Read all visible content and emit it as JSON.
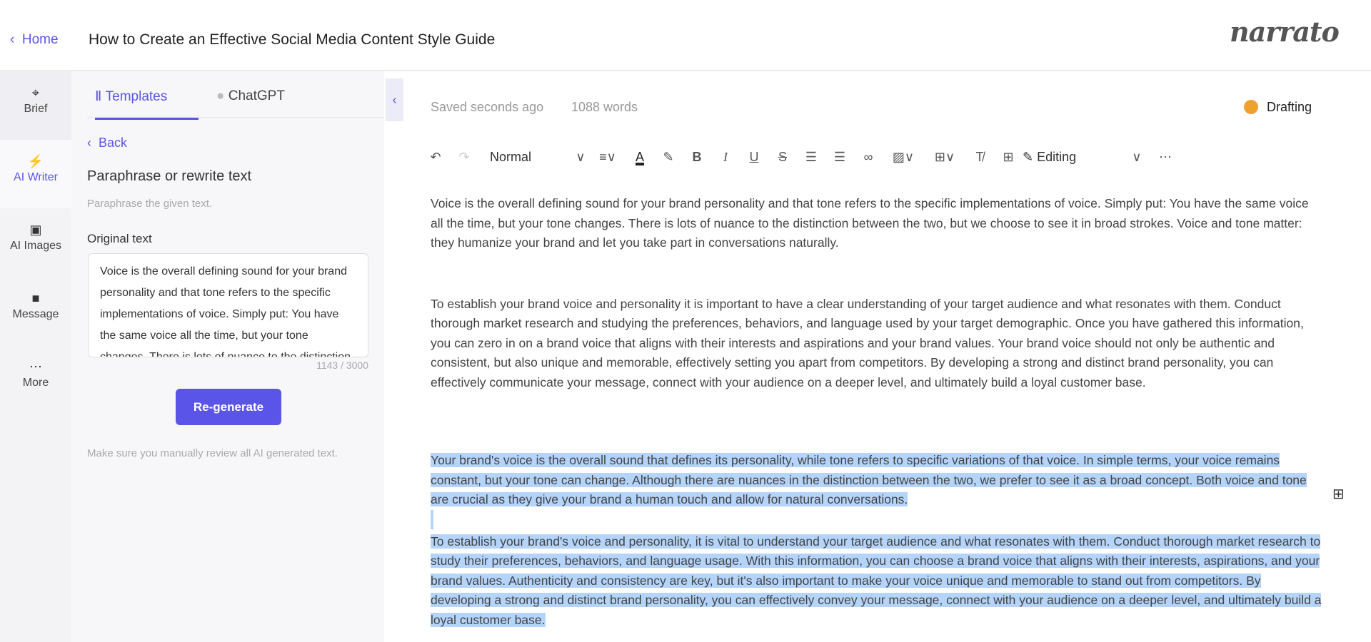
{
  "header": {
    "home_label": "Home",
    "title": "How to Create an Effective Social Media Content Style Guide",
    "logo": "narrato"
  },
  "rail": {
    "items": [
      {
        "label": "Brief",
        "icon": "crosshair-icon"
      },
      {
        "label": "AI Writer",
        "icon": "lightning-icon",
        "active": true
      },
      {
        "label": "AI Images",
        "icon": "image-icon"
      },
      {
        "label": "Message",
        "icon": "chat-icon"
      },
      {
        "label": "More",
        "icon": "ellipsis-icon"
      }
    ]
  },
  "panel": {
    "tabs": [
      {
        "label": "Templates",
        "active": true
      },
      {
        "label": "ChatGPT"
      }
    ],
    "back_label": "Back",
    "title": "Paraphrase or rewrite text",
    "subtitle": "Paraphrase the given text.",
    "original_label": "Original text",
    "original_value": "Voice is the overall defining sound for your brand personality and that tone refers to the specific implementations of voice. Simply put: You have the same voice all the time, but your tone changes. There is lots of nuance to the distinction between the two, but we choose to see it in broad strokes. Voice and tone matter: they humanize your brand and let you take part in conversations naturally.",
    "char_count": "1143 / 3000",
    "regenerate_label": "Re-generate",
    "note": "Make sure you manually review all AI generated text."
  },
  "editor": {
    "saved": "Saved seconds ago",
    "words": "1088 words",
    "status": "Drafting",
    "status_color": "#eea22d",
    "toolbar": {
      "style": "Normal",
      "mode": "Editing"
    },
    "paragraphs": [
      "Voice is the overall defining sound for your brand personality and that tone refers to the specific implementations of voice. Simply put: You have the same voice all the time, but your tone changes. There is lots of nuance to the distinction between the two, but we choose to see it in broad strokes. Voice and tone matter: they humanize your brand and let you take part in conversations naturally.",
      "To establish your brand voice and personality it is important to have a clear understanding of your target audience and what resonates with them. Conduct thorough market research and studying the preferences, behaviors, and language used by your target demographic. Once you have gathered this information, you can zero in on a brand voice that aligns with their interests and aspirations and your brand values. Your brand voice should not only be authentic and consistent, but also unique and memorable, effectively setting you apart from competitors. By developing a strong and distinct brand personality, you can effectively communicate your message, connect with your audience on a deeper level, and ultimately build a loyal customer base.",
      "Your brand's voice is the overall sound that defines its personality, while tone refers to specific variations of that voice. In simple terms, your voice remains constant, but your tone can change. Although there are nuances in the distinction between the two, we prefer to see it as a broad concept. Both voice and tone are crucial as they give your brand a human touch and allow for natural conversations.",
      "To establish your brand's voice and personality, it is vital to understand your target audience and what resonates with them. Conduct thorough market research to study their preferences, behaviors, and language usage. With this information, you can choose a brand voice that aligns with their interests, aspirations, and your brand values. Authenticity and consistency are key, but it's also important to make your voice unique and memorable to stand out from competitors. By developing a strong and distinct brand personality, you can effectively convey your message, connect with your audience on a deeper level, and ultimately build a loyal customer base."
    ]
  }
}
